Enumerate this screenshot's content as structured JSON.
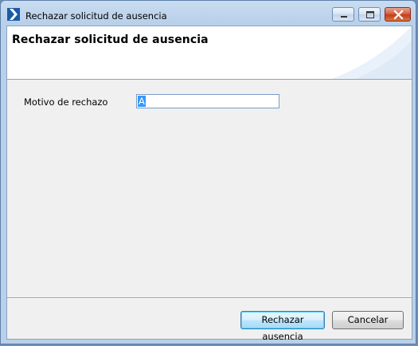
{
  "window": {
    "title": "Rechazar solicitud de ausencia",
    "icon": "app-arrow-icon",
    "controls": [
      "minimize-icon",
      "maximize-icon",
      "close-icon"
    ]
  },
  "header": {
    "title": "Rechazar solicitud de ausencia"
  },
  "form": {
    "motivo_label": "Motivo de rechazo",
    "motivo_value": "A"
  },
  "buttons": {
    "reject_label": "Rechazar ausencia",
    "cancel_label": "Cancelar"
  },
  "colors": {
    "accent": "#3399ff",
    "title_bar": "#c9dcf1",
    "close_button": "#c43d1c"
  }
}
